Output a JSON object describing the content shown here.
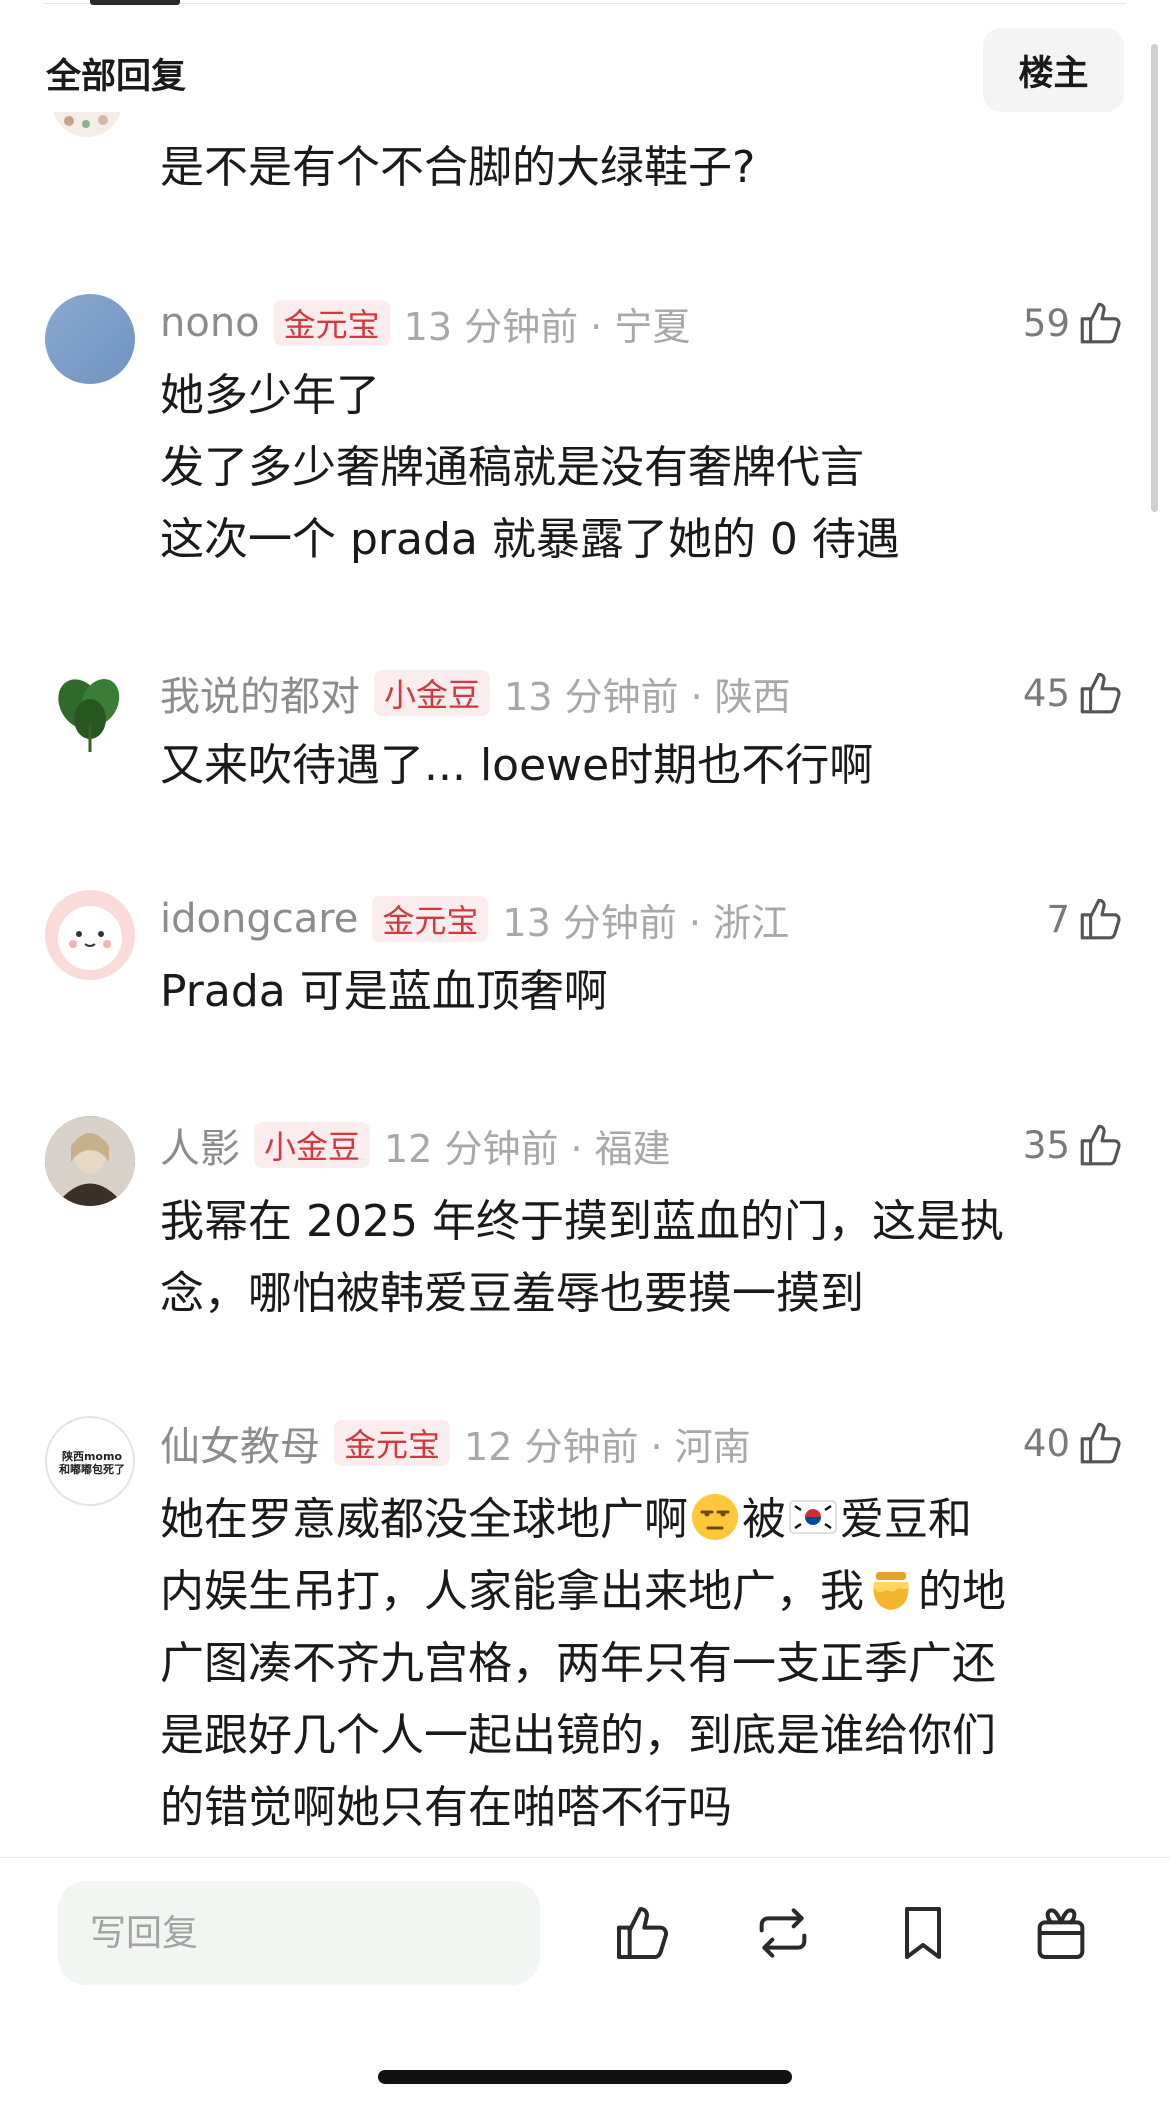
{
  "header": {
    "title": "全部回复",
    "op_button": "楼主"
  },
  "first_comment": {
    "text": "是不是有个不合脚的大绿鞋子?"
  },
  "comments": [
    {
      "username": "nono",
      "badge": "金元宝",
      "meta": "13 分钟前 · 宁夏",
      "likes": "59",
      "lines": [
        "她多少年了",
        "发了多少奢牌通稿就是没有奢牌代言",
        "这次一个 prada 就暴露了她的 0 待遇"
      ]
    },
    {
      "username": "我说的都对",
      "badge": "小金豆",
      "meta": "13 分钟前 · 陕西",
      "likes": "45",
      "lines": [
        "又来吹待遇了... loewe时期也不行啊"
      ]
    },
    {
      "username": "idongcare",
      "badge": "金元宝",
      "meta": "13 分钟前 · 浙江",
      "likes": "7",
      "lines": [
        "Prada 可是蓝血顶奢啊"
      ]
    },
    {
      "username": "人影",
      "badge": "小金豆",
      "meta": "12 分钟前 · 福建",
      "likes": "35",
      "lines": [
        "我幂在 2025 年终于摸到蓝血的门，这是执",
        "念，哪怕被韩爱豆羞辱也要摸一摸到"
      ]
    },
    {
      "username": "仙女教母",
      "badge": "金元宝",
      "meta": "12 分钟前 · 河南",
      "likes": "40",
      "avatar_text": [
        "陕西momo",
        "和嘟嘟包死了"
      ],
      "line1_a": "她在罗意威都没全球地广啊",
      "line1_b": "被",
      "line1_c": "爱豆和",
      "line2_a": "内娱生吊打，人家能拿出来地广，我",
      "line2_b": "的地",
      "lines_rest": [
        "广图凑不齐九宫格，两年只有一支正季广还",
        "是跟好几个人一起出镜的，到底是谁给你们",
        "的错觉啊她只有在啪嗒不行吗"
      ]
    }
  ],
  "bottom_bar": {
    "reply_placeholder": "写回复",
    "icons": [
      "thumbs-up-icon",
      "repost-icon",
      "bookmark-icon",
      "gift-icon"
    ]
  },
  "colors": {
    "badge_text": "#d2393f",
    "badge_bg": "#fbeced",
    "meta_gray": "#a8a8a8",
    "reply_bg": "#f1f6f3"
  }
}
